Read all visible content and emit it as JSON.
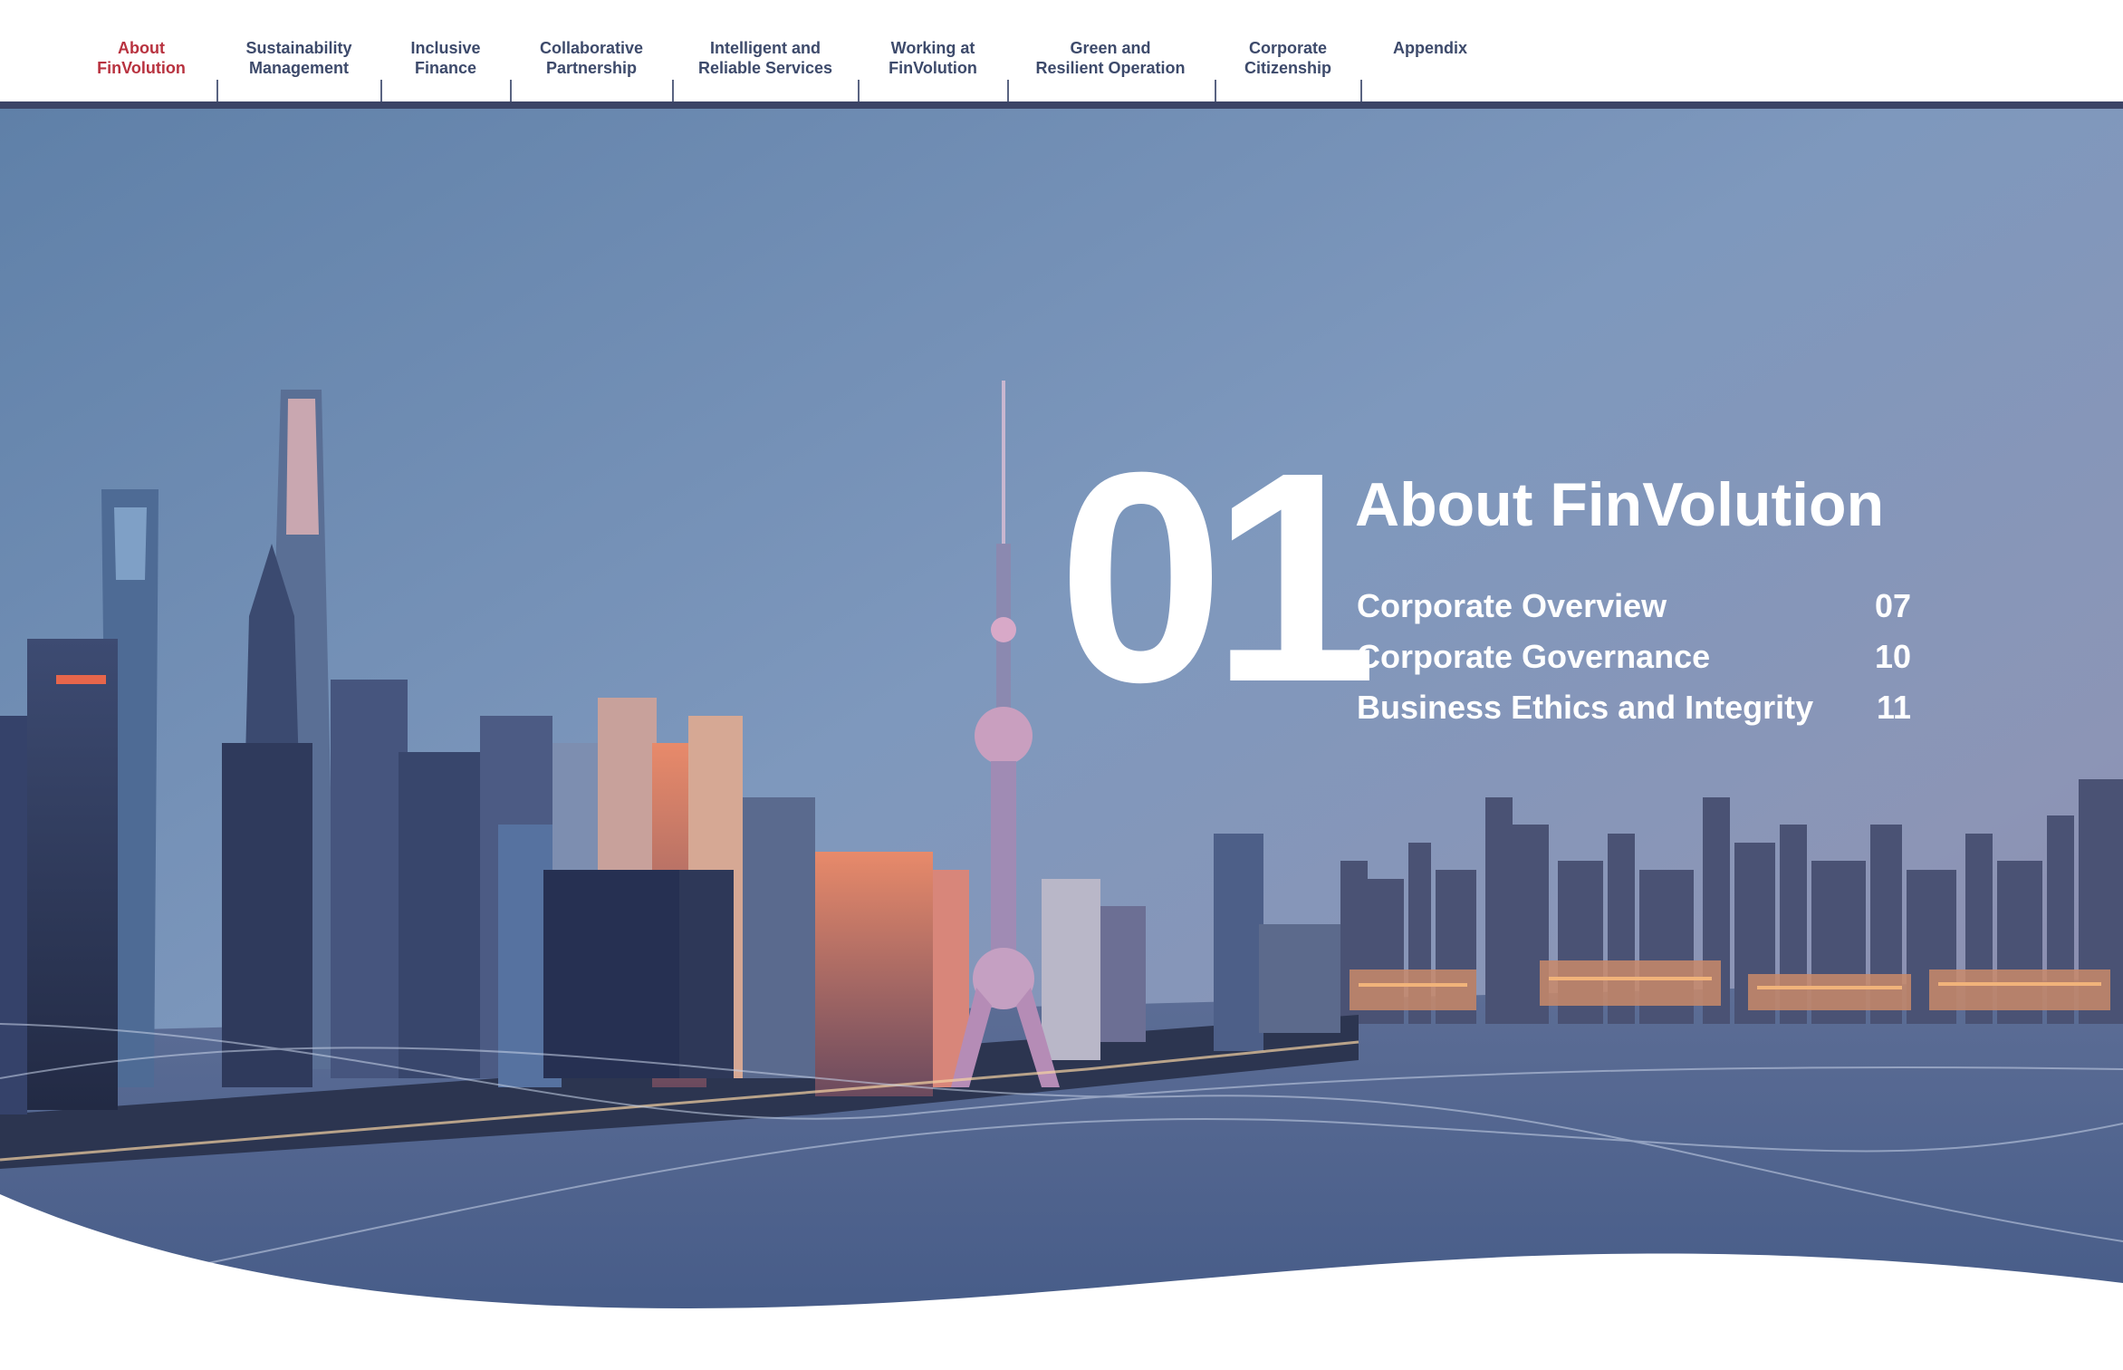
{
  "nav": {
    "items": [
      {
        "line1": "About",
        "line2": "FinVolution",
        "active": true
      },
      {
        "line1": "Sustainability",
        "line2": "Management"
      },
      {
        "line1": "Inclusive",
        "line2": "Finance"
      },
      {
        "line1": "Collaborative",
        "line2": "Partnership"
      },
      {
        "line1": "Intelligent and",
        "line2": "Reliable Services"
      },
      {
        "line1": "Working at",
        "line2": "FinVolution"
      },
      {
        "line1": "Green and",
        "line2": "Resilient Operation"
      },
      {
        "line1": "Corporate",
        "line2": "Citizenship"
      },
      {
        "line1": "Appendix",
        "line2": ""
      }
    ],
    "active_color": "#b8323f",
    "text_color": "#3d4a6b",
    "bar_color": "#3b4466"
  },
  "chapter": {
    "number": "01",
    "title": "About FinVolution",
    "toc": [
      {
        "label": "Corporate Overview",
        "page": "07"
      },
      {
        "label": "Corporate Governance",
        "page": "10"
      },
      {
        "label": "Business Ethics and Integrity",
        "page": "11"
      }
    ]
  }
}
